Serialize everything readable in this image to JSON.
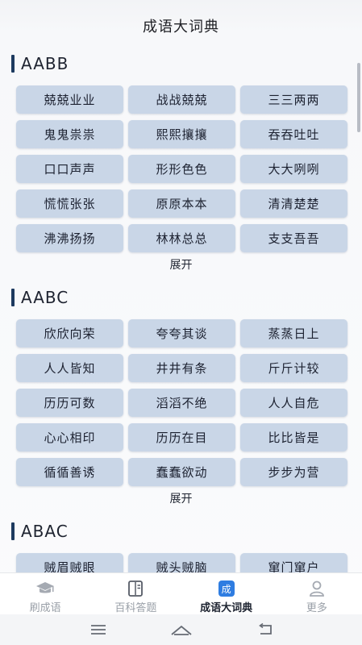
{
  "header": {
    "title": "成语大词典"
  },
  "sections": [
    {
      "title": "AABB",
      "items": [
        "兢兢业业",
        "战战兢兢",
        "三三两两",
        "鬼鬼祟祟",
        "熙熙攘攘",
        "吞吞吐吐",
        "口口声声",
        "形形色色",
        "大大咧咧",
        "慌慌张张",
        "原原本本",
        "清清楚楚",
        "沸沸扬扬",
        "林林总总",
        "支支吾吾"
      ],
      "expand_label": "展开"
    },
    {
      "title": "AABC",
      "items": [
        "欣欣向荣",
        "夸夸其谈",
        "蒸蒸日上",
        "人人皆知",
        "井井有条",
        "斤斤计较",
        "历历可数",
        "滔滔不绝",
        "人人自危",
        "心心相印",
        "历历在目",
        "比比皆是",
        "循循善诱",
        "蠢蠢欲动",
        "步步为营"
      ],
      "expand_label": "展开"
    },
    {
      "title": "ABAC",
      "items": [
        "贼眉贼眼",
        "贼头贼脑",
        "窜门窜户"
      ]
    }
  ],
  "tabbar": {
    "tabs": [
      {
        "label": "刷成语",
        "icon": "graduation-cap-icon"
      },
      {
        "label": "百科答题",
        "icon": "book-icon"
      },
      {
        "label": "成语大词典",
        "icon": "dictionary-icon",
        "icon_text": "成",
        "active": true
      },
      {
        "label": "更多",
        "icon": "user-icon"
      }
    ]
  },
  "navbar": {
    "icons": [
      "menu-icon",
      "home-icon",
      "back-icon"
    ]
  },
  "colors": {
    "chip_bg": "#c9d6e7",
    "accent": "#2f7de1",
    "section_bar": "#1d3a5f"
  }
}
